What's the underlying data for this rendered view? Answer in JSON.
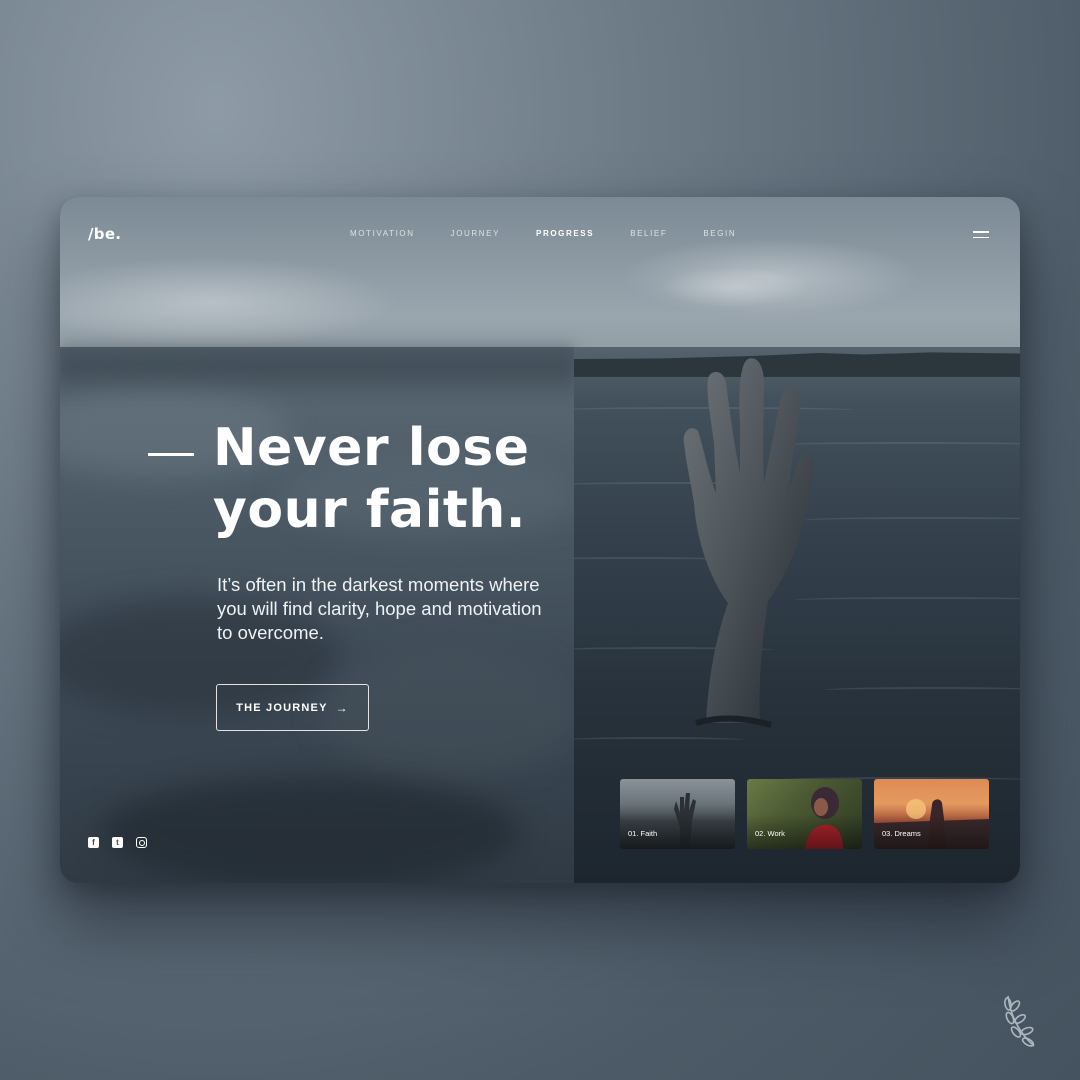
{
  "logo": "/be.",
  "nav": {
    "items": [
      {
        "label": "MOTIVATION",
        "active": false
      },
      {
        "label": "JOURNEY",
        "active": false
      },
      {
        "label": "PROGRESS",
        "active": true
      },
      {
        "label": "BELIEF",
        "active": false
      },
      {
        "label": "BEGIN",
        "active": false
      }
    ]
  },
  "icons": {
    "menu": "hamburger-menu-icon",
    "arrow": "arrow-right-icon",
    "social": [
      "facebook-icon",
      "twitter-icon",
      "instagram-icon"
    ],
    "corner": "laurel-icon"
  },
  "hero": {
    "headline_line1": "Never lose",
    "headline_line2": "your faith.",
    "subtext": "It’s often in the darkest moments where you will find clarity, hope and motivation to overcome.",
    "cta_label": "THE JOURNEY",
    "cta_arrow": "→"
  },
  "thumbnails": [
    {
      "label": "01. Faith"
    },
    {
      "label": "02. Work"
    },
    {
      "label": "03. Dreams"
    }
  ],
  "colors": {
    "background": "#5f6d79",
    "text": "#ffffff",
    "card": "#3b4853"
  }
}
